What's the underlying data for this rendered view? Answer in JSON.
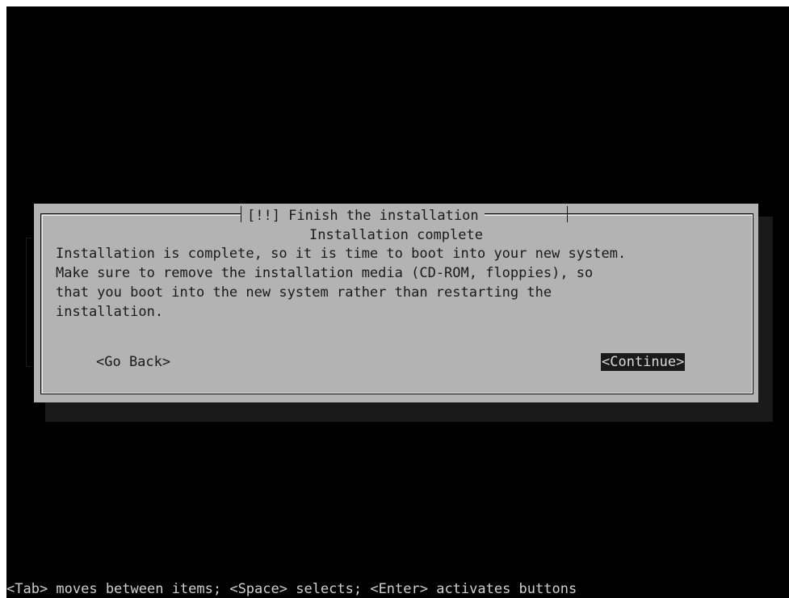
{
  "dialog": {
    "title": "[!!] Finish the installation",
    "subtitle": "Installation complete",
    "message": "Installation is complete, so it is time to boot into your new system.\nMake sure to remove the installation media (CD-ROM, floppies), so\nthat you boot into the new system rather than restarting the\ninstallation.",
    "buttons": {
      "go_back": "<Go Back>",
      "continue": "<Continue>"
    }
  },
  "help_line": "<Tab> moves between items; <Space> selects; <Enter> activates buttons",
  "colors": {
    "screen_background": "#000000",
    "dialog_background": "#b3b3b3",
    "selected_button_background": "#1a1a1a",
    "selected_button_text": "#d9d9d9",
    "help_text": "#cfcfcf"
  }
}
